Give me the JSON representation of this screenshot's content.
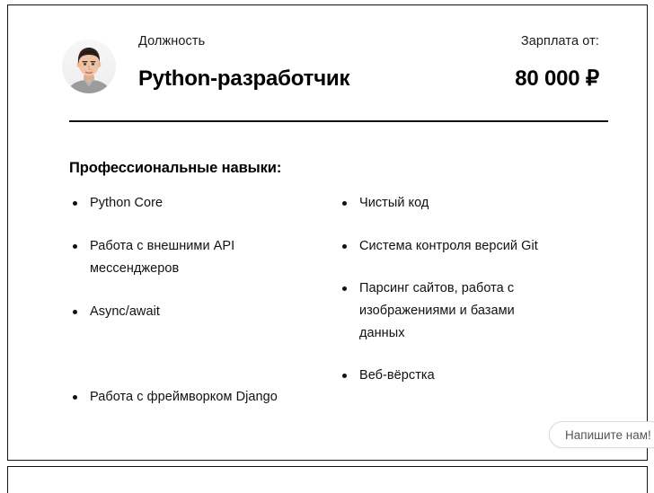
{
  "card": {
    "avatar_alt": "avatar-photo",
    "position_label": "Должность",
    "job_title": "Python-разработчик",
    "salary_label": "Зарплата от:",
    "salary_value": "80 000 ₽",
    "skills_heading": "Профессиональные навыки:",
    "skills_left": [
      "Python Core",
      "Работа с внешними API мессенджеров",
      "Async/await",
      "Работа с фреймворком Django"
    ],
    "skills_right": [
      "Чистый код",
      "Система контроля версий Git",
      "Парсинг сайтов, работа с изображениями и базами данных",
      "Веб-вёрстка"
    ]
  },
  "chat": {
    "button_label": "Напишите нам!"
  },
  "colors": {
    "text": "#111111",
    "border": "#111111",
    "chat_border": "#d9d9d9",
    "chat_text": "#555555"
  }
}
